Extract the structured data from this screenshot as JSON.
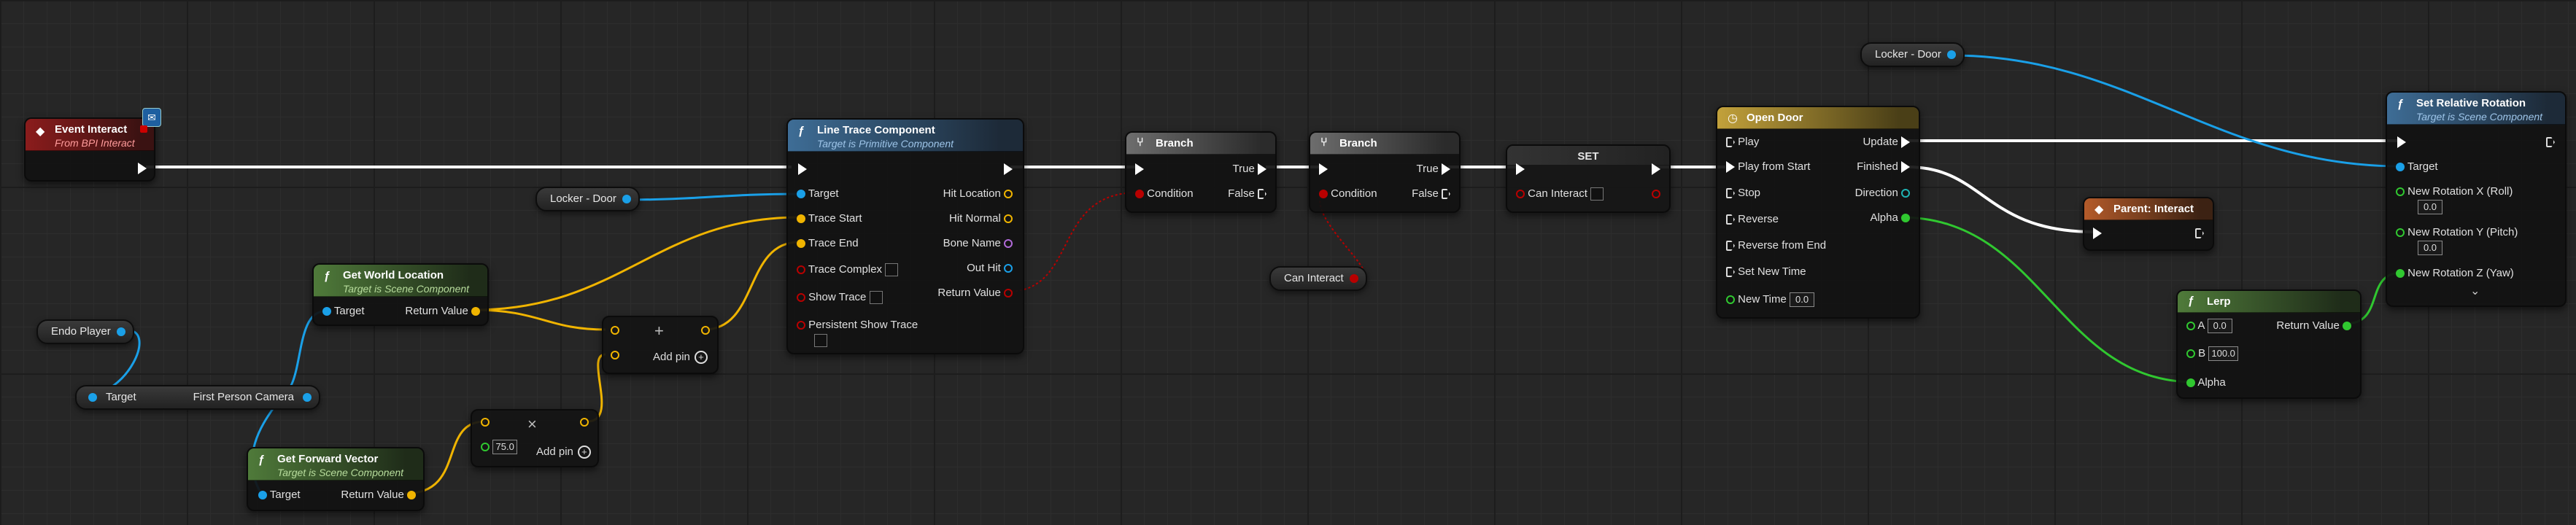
{
  "colors": {
    "canvas": "#262626",
    "exec": "#ffffff",
    "object": "#1aa0e8",
    "vector": "#f0b400",
    "bool": "#b80000",
    "float": "#30c830"
  },
  "event_interact": {
    "title": "Event Interact",
    "subtitle": "From BPI Interact",
    "icon": "event-diamond-icon"
  },
  "endo_player": {
    "label": "Endo Player"
  },
  "first_person_camera": {
    "target": "Target",
    "output": "First Person Camera"
  },
  "get_world_location": {
    "title": "Get World Location",
    "subtitle": "Target is Scene Component",
    "target": "Target",
    "output": "Return Value"
  },
  "get_forward_vector": {
    "title": "Get Forward Vector",
    "subtitle": "Target is Scene Component",
    "target": "Target",
    "output": "Return Value"
  },
  "multiply": {
    "value": "75.0",
    "add_pin": "Add pin"
  },
  "add": {
    "add_pin": "Add pin"
  },
  "locker_door_1": {
    "label": "Locker - Door"
  },
  "locker_door_2": {
    "label": "Locker - Door"
  },
  "line_trace": {
    "title": "Line Trace Component",
    "subtitle": "Target is Primitive Component",
    "inputs": [
      "Target",
      "Trace Start",
      "Trace End",
      "Trace Complex",
      "Show Trace",
      "Persistent Show Trace"
    ],
    "outputs": [
      "Hit Location",
      "Hit Normal",
      "Bone Name",
      "Out Hit",
      "Return Value"
    ]
  },
  "branch_1": {
    "title": "Branch",
    "condition": "Condition",
    "true_label": "True",
    "false_label": "False"
  },
  "branch_2": {
    "title": "Branch",
    "condition": "Condition",
    "true_label": "True",
    "false_label": "False"
  },
  "can_interact_get": {
    "label": "Can Interact"
  },
  "set_node": {
    "title": "SET",
    "field": "Can Interact"
  },
  "open_door": {
    "title": "Open Door",
    "inputs": [
      "Play",
      "Play from Start",
      "Stop",
      "Reverse",
      "Reverse from End",
      "Set New Time",
      "New Time"
    ],
    "new_time_value": "0.0",
    "outputs": [
      "Update",
      "Finished",
      "Direction",
      "Alpha"
    ]
  },
  "parent_interact": {
    "title": "Parent: Interact"
  },
  "lerp": {
    "title": "Lerp",
    "a_label": "A",
    "a_value": "0.0",
    "b_label": "B",
    "b_value": "100.0",
    "alpha": "Alpha",
    "output": "Return Value"
  },
  "set_relative_rotation": {
    "title": "Set Relative Rotation",
    "subtitle": "Target is Scene Component",
    "target": "Target",
    "roll": "New Rotation X (Roll)",
    "roll_value": "0.0",
    "pitch": "New Rotation Y (Pitch)",
    "pitch_value": "0.0",
    "yaw": "New Rotation Z (Yaw)"
  }
}
